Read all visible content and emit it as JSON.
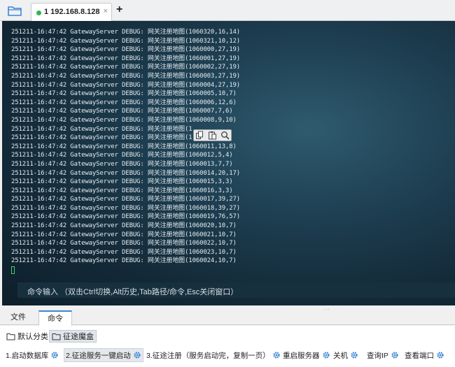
{
  "session": {
    "label": "1 192.168.8.128",
    "close": "×"
  },
  "log_lines": [
    "251211-16:47:42 GatewayServer DEBUG: 网关注册地图(1060320,16,14)",
    "251211-16:47:42 GatewayServer DEBUG: 网关注册地图(1060321,10,12)",
    "251211-16:47:42 GatewayServer DEBUG: 网关注册地图(1060000,27,19)",
    "251211-16:47:42 GatewayServer DEBUG: 网关注册地图(1060001,27,19)",
    "251211-16:47:42 GatewayServer DEBUG: 网关注册地图(1060002,27,19)",
    "251211-16:47:42 GatewayServer DEBUG: 网关注册地图(1060003,27,19)",
    "251211-16:47:42 GatewayServer DEBUG: 网关注册地图(1060004,27,19)",
    "251211-16:47:42 GatewayServer DEBUG: 网关注册地图(1060005,10,7)",
    "251211-16:47:42 GatewayServer DEBUG: 网关注册地图(1060006,12,6)",
    "251211-16:47:42 GatewayServer DEBUG: 网关注册地图(1060007,7,6)",
    "251211-16:47:42 GatewayServer DEBUG: 网关注册地图(1060008,9,10)",
    "251211-16:47:42 GatewayServer DEBUG: 网关注册地图(1",
    "251211-16:47:42 GatewayServer DEBUG: 网关注册地图(1",
    "251211-16:47:42 GatewayServer DEBUG: 网关注册地图(1060011,13,8)",
    "251211-16:47:42 GatewayServer DEBUG: 网关注册地图(1060012,5,4)",
    "251211-16:47:42 GatewayServer DEBUG: 网关注册地图(1060013,7,7)",
    "251211-16:47:42 GatewayServer DEBUG: 网关注册地图(1060014,20,17)",
    "251211-16:47:42 GatewayServer DEBUG: 网关注册地图(1060015,3,3)",
    "251211-16:47:42 GatewayServer DEBUG: 网关注册地图(1060016,3,3)",
    "251211-16:47:42 GatewayServer DEBUG: 网关注册地图(1060017,39,27)",
    "251211-16:47:42 GatewayServer DEBUG: 网关注册地图(1060018,39,27)",
    "251211-16:47:42 GatewayServer DEBUG: 网关注册地图(1060019,76,57)",
    "251211-16:47:42 GatewayServer DEBUG: 网关注册地图(1060020,10,7)",
    "251211-16:47:42 GatewayServer DEBUG: 网关注册地图(1060021,10,7)",
    "251211-16:47:42 GatewayServer DEBUG: 网关注册地图(1060022,10,7)",
    "251211-16:47:42 GatewayServer DEBUG: 网关注册地图(1060023,10,7)",
    "251211-16:47:42 GatewayServer DEBUG: 网关注册地图(1060024,10,7)"
  ],
  "command_input": {
    "placeholder": "命令输入 （双击Ctrl切换,Alt历史,Tab路径/命令,Esc关闭窗口）"
  },
  "splitter": "...",
  "lower_tabs": {
    "files": "文件",
    "commands": "命令"
  },
  "groups": {
    "default": "默认分类",
    "magic_box": "征途魔盒"
  },
  "commands": [
    {
      "label": "1.启动数据库"
    },
    {
      "label": "2.征途服务一键启动"
    },
    {
      "label": "3.征途注册（服务启动完，复制一页）"
    },
    {
      "label": "重启服务器"
    },
    {
      "label": "关机"
    },
    {
      "label": "查询IP"
    },
    {
      "label": "查看端口"
    }
  ],
  "colors": {
    "accent": "#3b86d6",
    "status_dot": "#2db84d",
    "cursor": "#3fd06a",
    "gear": "#3b86d6"
  },
  "icons": {
    "folder": "folder-icon",
    "add": "plus-icon",
    "copy": "copy-icon",
    "paste": "paste-icon",
    "search": "search-icon",
    "group": "folder-outline-icon",
    "gear": "gear-icon"
  }
}
